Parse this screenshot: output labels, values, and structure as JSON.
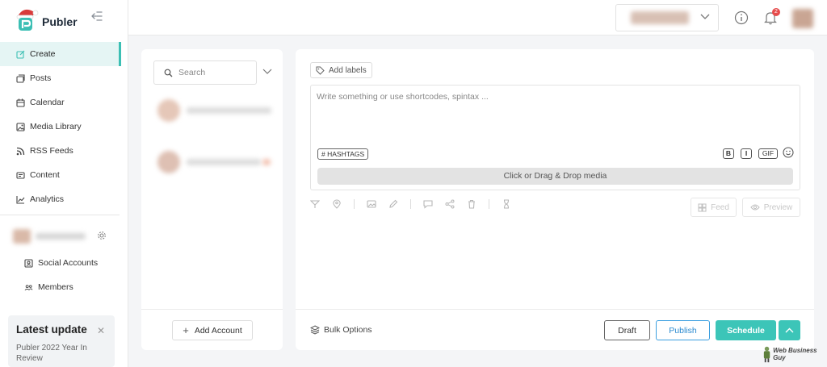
{
  "app": {
    "name": "Publer",
    "brand_color": "#3cbfb4"
  },
  "sidebar": {
    "items": [
      {
        "label": "Create",
        "icon": "edit-icon",
        "active": true
      },
      {
        "label": "Posts",
        "icon": "posts-icon"
      },
      {
        "label": "Calendar",
        "icon": "calendar-icon"
      },
      {
        "label": "Media Library",
        "icon": "image-icon"
      },
      {
        "label": "RSS Feeds",
        "icon": "rss-icon"
      },
      {
        "label": "Content",
        "icon": "content-icon"
      },
      {
        "label": "Analytics",
        "icon": "chart-icon"
      }
    ],
    "workspace_items": [
      {
        "label": "Social Accounts",
        "icon": "contacts-icon"
      },
      {
        "label": "Members",
        "icon": "users-icon"
      }
    ],
    "update_card": {
      "title": "Latest update",
      "text": "Publer 2022 Year In Review"
    }
  },
  "topbar": {
    "notification_count": "2"
  },
  "accounts": {
    "search_placeholder": "Search",
    "add_account_label": "Add Account"
  },
  "composer": {
    "add_labels": "Add labels",
    "placeholder": "Write something or use shortcodes, spintax ...",
    "hashtags_label": "# HASHTAGS",
    "bold_label": "B",
    "italic_label": "I",
    "gif_label": "GIF",
    "dropzone_label": "Click or Drag & Drop media",
    "feed_label": "Feed",
    "preview_label": "Preview",
    "bulk_options": "Bulk Options",
    "draft_label": "Draft",
    "publish_label": "Publish",
    "schedule_label": "Schedule"
  },
  "watermark": "Web Business Guy"
}
